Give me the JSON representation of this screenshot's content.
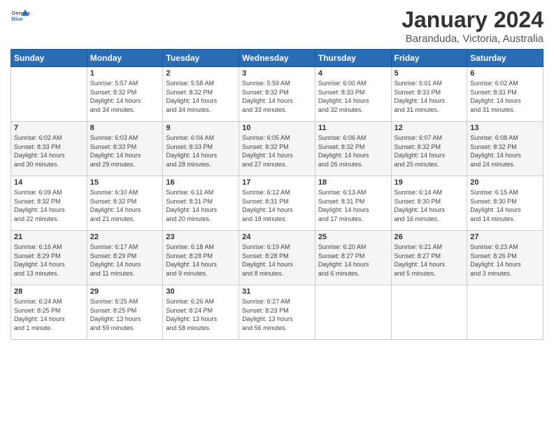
{
  "logo": {
    "general": "General",
    "blue": "Blue"
  },
  "title": "January 2024",
  "subtitle": "Baranduda, Victoria, Australia",
  "days_header": [
    "Sunday",
    "Monday",
    "Tuesday",
    "Wednesday",
    "Thursday",
    "Friday",
    "Saturday"
  ],
  "weeks": [
    [
      {
        "day": "",
        "info": ""
      },
      {
        "day": "1",
        "info": "Sunrise: 5:57 AM\nSunset: 8:32 PM\nDaylight: 14 hours\nand 34 minutes."
      },
      {
        "day": "2",
        "info": "Sunrise: 5:58 AM\nSunset: 8:32 PM\nDaylight: 14 hours\nand 34 minutes."
      },
      {
        "day": "3",
        "info": "Sunrise: 5:59 AM\nSunset: 8:32 PM\nDaylight: 14 hours\nand 33 minutes."
      },
      {
        "day": "4",
        "info": "Sunrise: 6:00 AM\nSunset: 8:33 PM\nDaylight: 14 hours\nand 32 minutes."
      },
      {
        "day": "5",
        "info": "Sunrise: 6:01 AM\nSunset: 8:33 PM\nDaylight: 14 hours\nand 31 minutes."
      },
      {
        "day": "6",
        "info": "Sunrise: 6:02 AM\nSunset: 8:33 PM\nDaylight: 14 hours\nand 31 minutes."
      }
    ],
    [
      {
        "day": "7",
        "info": "Sunrise: 6:02 AM\nSunset: 8:33 PM\nDaylight: 14 hours\nand 30 minutes."
      },
      {
        "day": "8",
        "info": "Sunrise: 6:03 AM\nSunset: 8:33 PM\nDaylight: 14 hours\nand 29 minutes."
      },
      {
        "day": "9",
        "info": "Sunrise: 6:04 AM\nSunset: 8:33 PM\nDaylight: 14 hours\nand 28 minutes."
      },
      {
        "day": "10",
        "info": "Sunrise: 6:05 AM\nSunset: 8:32 PM\nDaylight: 14 hours\nand 27 minutes."
      },
      {
        "day": "11",
        "info": "Sunrise: 6:06 AM\nSunset: 8:32 PM\nDaylight: 14 hours\nand 26 minutes."
      },
      {
        "day": "12",
        "info": "Sunrise: 6:07 AM\nSunset: 8:32 PM\nDaylight: 14 hours\nand 25 minutes."
      },
      {
        "day": "13",
        "info": "Sunrise: 6:08 AM\nSunset: 8:32 PM\nDaylight: 14 hours\nand 24 minutes."
      }
    ],
    [
      {
        "day": "14",
        "info": "Sunrise: 6:09 AM\nSunset: 8:32 PM\nDaylight: 14 hours\nand 22 minutes."
      },
      {
        "day": "15",
        "info": "Sunrise: 6:10 AM\nSunset: 8:32 PM\nDaylight: 14 hours\nand 21 minutes."
      },
      {
        "day": "16",
        "info": "Sunrise: 6:11 AM\nSunset: 8:31 PM\nDaylight: 14 hours\nand 20 minutes."
      },
      {
        "day": "17",
        "info": "Sunrise: 6:12 AM\nSunset: 8:31 PM\nDaylight: 14 hours\nand 18 minutes."
      },
      {
        "day": "18",
        "info": "Sunrise: 6:13 AM\nSunset: 8:31 PM\nDaylight: 14 hours\nand 17 minutes."
      },
      {
        "day": "19",
        "info": "Sunrise: 6:14 AM\nSunset: 8:30 PM\nDaylight: 14 hours\nand 16 minutes."
      },
      {
        "day": "20",
        "info": "Sunrise: 6:15 AM\nSunset: 8:30 PM\nDaylight: 14 hours\nand 14 minutes."
      }
    ],
    [
      {
        "day": "21",
        "info": "Sunrise: 6:16 AM\nSunset: 8:29 PM\nDaylight: 14 hours\nand 13 minutes."
      },
      {
        "day": "22",
        "info": "Sunrise: 6:17 AM\nSunset: 8:29 PM\nDaylight: 14 hours\nand 11 minutes."
      },
      {
        "day": "23",
        "info": "Sunrise: 6:18 AM\nSunset: 8:28 PM\nDaylight: 14 hours\nand 9 minutes."
      },
      {
        "day": "24",
        "info": "Sunrise: 6:19 AM\nSunset: 8:28 PM\nDaylight: 14 hours\nand 8 minutes."
      },
      {
        "day": "25",
        "info": "Sunrise: 6:20 AM\nSunset: 8:27 PM\nDaylight: 14 hours\nand 6 minutes."
      },
      {
        "day": "26",
        "info": "Sunrise: 6:21 AM\nSunset: 8:27 PM\nDaylight: 14 hours\nand 5 minutes."
      },
      {
        "day": "27",
        "info": "Sunrise: 6:23 AM\nSunset: 8:26 PM\nDaylight: 14 hours\nand 3 minutes."
      }
    ],
    [
      {
        "day": "28",
        "info": "Sunrise: 6:24 AM\nSunset: 8:25 PM\nDaylight: 14 hours\nand 1 minute."
      },
      {
        "day": "29",
        "info": "Sunrise: 6:25 AM\nSunset: 8:25 PM\nDaylight: 13 hours\nand 59 minutes."
      },
      {
        "day": "30",
        "info": "Sunrise: 6:26 AM\nSunset: 8:24 PM\nDaylight: 13 hours\nand 58 minutes."
      },
      {
        "day": "31",
        "info": "Sunrise: 6:27 AM\nSunset: 8:23 PM\nDaylight: 13 hours\nand 56 minutes."
      },
      {
        "day": "",
        "info": ""
      },
      {
        "day": "",
        "info": ""
      },
      {
        "day": "",
        "info": ""
      }
    ]
  ]
}
